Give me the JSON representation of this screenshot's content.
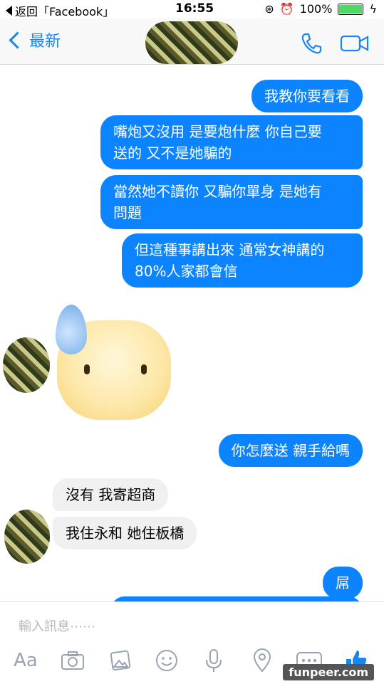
{
  "status_bar": {
    "back_label": "返回「Facebook」",
    "time": "16:55",
    "battery_percent": "100%",
    "battery_level": 1.0
  },
  "header": {
    "back_label": "最新",
    "phone_icon": "phone-icon",
    "video_icon": "video-camera-icon"
  },
  "messages": [
    {
      "dir": "out",
      "text": "我教你要看看"
    },
    {
      "dir": "out",
      "text": "嘴炮又沒用 是要炮什麼 你自己要\n送的 又不是她騙的"
    },
    {
      "dir": "out",
      "text": "當然她不讀你 又騙你單身 是她有\n問題"
    },
    {
      "dir": "out",
      "text": "但這種事講出來 通常女神講的\n80%人家都會信"
    },
    {
      "dir": "in_sticker",
      "text": ""
    },
    {
      "dir": "out",
      "text": "你怎麼送 親手給嗎"
    },
    {
      "dir": "in",
      "text": "沒有 我寄超商"
    },
    {
      "dir": "in",
      "text": "我住永和 她住板橋"
    },
    {
      "dir": "out",
      "text": "屌"
    }
  ],
  "composer": {
    "placeholder": "輸入訊息⋯⋯",
    "text_tool_label": "Aa"
  },
  "watermark": "funpeer.com",
  "colors": {
    "accent": "#1a86f0",
    "outgoing_bubble": "#0d84ff",
    "incoming_bubble": "#f0f0f0"
  }
}
